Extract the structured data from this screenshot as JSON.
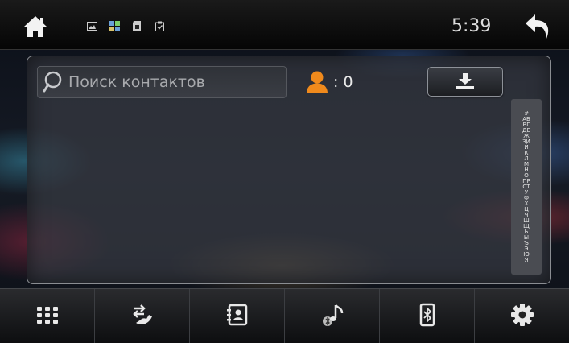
{
  "status_bar": {
    "time": "5:39",
    "icons": [
      "home-icon",
      "gallery-icon",
      "apps-grid-icon",
      "sd-card-icon",
      "clipboard-icon",
      "back-arrow-icon"
    ]
  },
  "contacts": {
    "search_placeholder": "Поиск контактов",
    "count_label": ": 0",
    "download_icon": "download-icon",
    "alphabet_index": "#АБВГДЕЖЗИЙКЛМНОПРСТУФХЦЧШЩЬЫЪЭЮЯ"
  },
  "bottom_nav": [
    {
      "id": "menu",
      "icon": "dots-grid-icon"
    },
    {
      "id": "calls",
      "icon": "call-log-icon"
    },
    {
      "id": "contacts",
      "icon": "contacts-book-icon"
    },
    {
      "id": "bt-music",
      "icon": "bluetooth-music-icon"
    },
    {
      "id": "phone",
      "icon": "bluetooth-phone-icon"
    },
    {
      "id": "settings",
      "icon": "gear-icon"
    }
  ],
  "colors": {
    "accent_orange": "#f08a1c",
    "text_light": "#e8e8e8",
    "panel_border": "#8a8d92"
  }
}
